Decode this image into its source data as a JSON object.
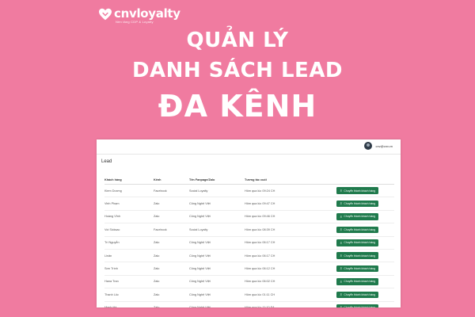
{
  "brand": {
    "name": "cnvloyalty",
    "tagline": "Nền tảng CDP & Loyalty"
  },
  "headline": {
    "line1": "QUẢN LÝ",
    "line2": "DANH SÁCH LEAD",
    "line3": "ĐA KÊNH"
  },
  "topbar": {
    "user_email": "cnv@cnv.vn"
  },
  "section_title": "Lead",
  "table": {
    "headers": [
      "Khách hàng",
      "Kênh",
      "Tên Fanpage/Zalo",
      "Tương tác cuối",
      ""
    ],
    "button_label": "Chuyển thành khách hàng",
    "rows": [
      {
        "customer": "Kiem Dương",
        "channel": "Facebook",
        "page": "Social Loyalty",
        "last": "Hôm qua lúc 09:24 CH"
      },
      {
        "customer": "Vinh Phạm",
        "channel": "Zalo",
        "page": "Công Nghệ Việt",
        "last": "Hôm qua lúc 09:47 CH"
      },
      {
        "customer": "Hoàng Vĩnh",
        "channel": "Zalo",
        "page": "Công Nghệ Việt",
        "last": "Hôm qua lúc 09:46 CH"
      },
      {
        "customer": "Voi Sicksac",
        "channel": "Facebook",
        "page": "Social Loyalty",
        "last": "Hôm qua lúc 08:39 CH"
      },
      {
        "customer": "Trí Nguyễn",
        "channel": "Zalo",
        "page": "Công Nghệ Việt",
        "last": "Hôm qua lúc 06:17 CH"
      },
      {
        "customer": "Linân",
        "channel": "Zalo",
        "page": "Công Nghệ Việt",
        "last": "Hôm qua lúc 06:17 CH"
      },
      {
        "customer": "Sơn Trình",
        "channel": "Zalo",
        "page": "Công Nghệ Việt",
        "last": "Hôm qua lúc 06:12 CH"
      },
      {
        "customer": "Hana Tran",
        "channel": "Zalo",
        "page": "Công Nghệ Việt",
        "last": "Hôm qua lúc 06:02 CH"
      },
      {
        "customer": "Thanh Lôc",
        "channel": "Zalo",
        "page": "Công Nghệ Việt",
        "last": "Hôm qua lúc 01:11 CH"
      },
      {
        "customer": "Mạnh Hà",
        "channel": "Zalo",
        "page": "Công Nghệ Việt",
        "last": "Hôm qua lúc 11:10 SA"
      }
    ]
  },
  "icons": {
    "logo": "heart-logo-icon",
    "avatar": "user-avatar",
    "button": "user-icon"
  },
  "colors": {
    "background": "#f07ba0",
    "button": "#1f7a4c",
    "text_light": "#ffffff"
  }
}
